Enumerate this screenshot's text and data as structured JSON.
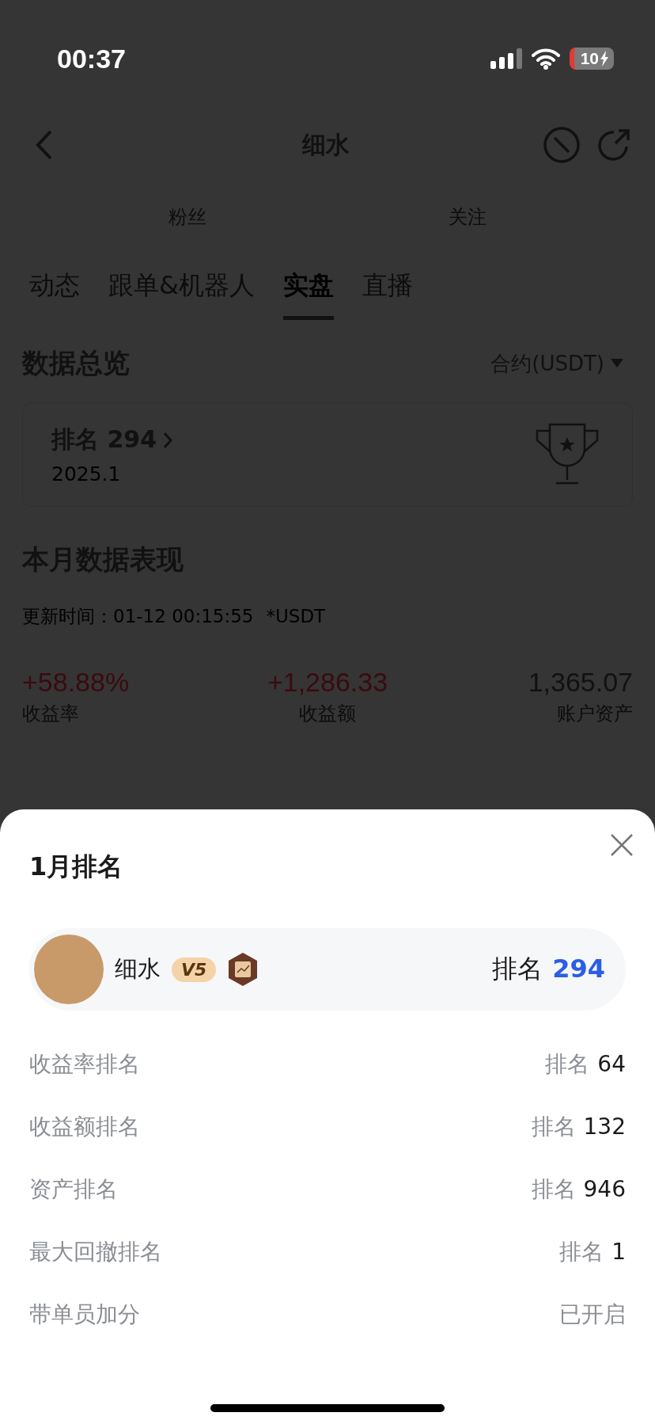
{
  "status_bar": {
    "time": "00:37",
    "battery": "10"
  },
  "nav": {
    "title": "细水"
  },
  "profile_stats": [
    {
      "label": "粉丝"
    },
    {
      "label": "关注"
    }
  ],
  "tabs": [
    {
      "label": "动态",
      "selected": false
    },
    {
      "label": "跟单&机器人",
      "selected": false
    },
    {
      "label": "实盘",
      "selected": true
    },
    {
      "label": "直播",
      "selected": false
    }
  ],
  "overview": {
    "title": "数据总览",
    "selector": "合约(USDT)",
    "rank_card": {
      "rank": "排名 294",
      "period": "2025.1"
    }
  },
  "monthly": {
    "title": "本月数据表现",
    "update_time": "更新时间：01-12 00:15:55",
    "unit": "*USDT",
    "metrics": [
      {
        "value": "+58.88%",
        "label": "收益率",
        "color": "#3a0a10"
      },
      {
        "value": "+1,286.33",
        "label": "收益额",
        "color": "#3a0a10"
      },
      {
        "value": "1,365.07",
        "label": "账户资产",
        "color": "#111111"
      }
    ]
  },
  "sheet": {
    "title": "1月排名",
    "user": {
      "name": "细水",
      "vip": "V5",
      "rank_label": "排名",
      "rank_value": "294"
    },
    "rows": [
      {
        "kind": "rank",
        "label": "收益率排名",
        "prefix": "排名",
        "value": "64"
      },
      {
        "kind": "rank",
        "label": "收益额排名",
        "prefix": "排名",
        "value": "132"
      },
      {
        "kind": "rank",
        "label": "资产排名",
        "prefix": "排名",
        "value": "946"
      },
      {
        "kind": "rank",
        "label": "最大回撤排名",
        "prefix": "排名",
        "value": "1"
      },
      {
        "kind": "status",
        "label": "带单员加分",
        "value": "已开启"
      }
    ]
  }
}
